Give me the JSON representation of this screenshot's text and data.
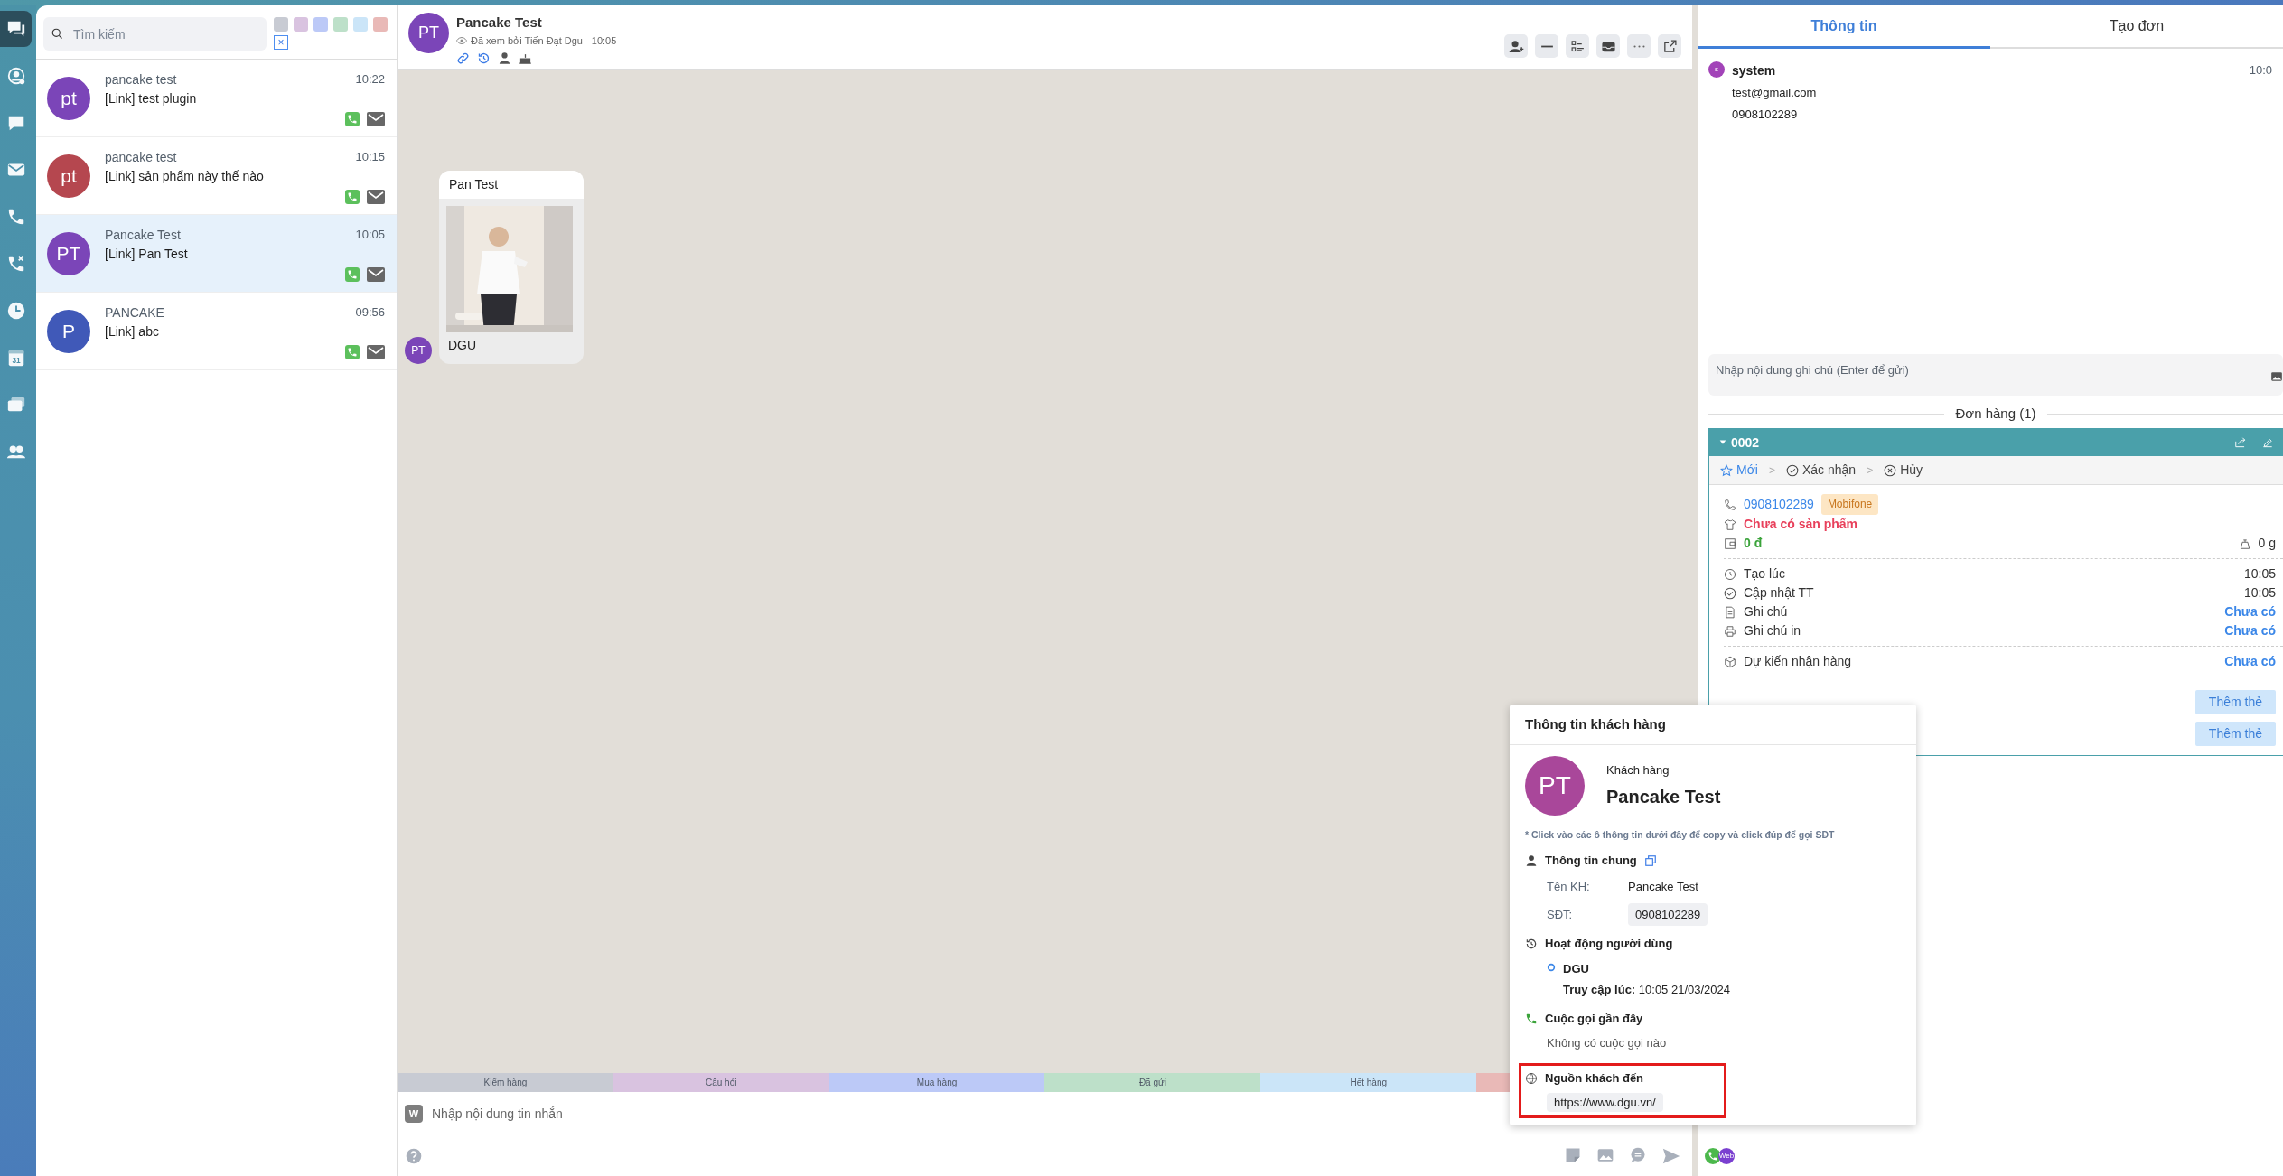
{
  "rail": [
    {
      "kind": "chat",
      "selected": true
    },
    {
      "kind": "contact",
      "selected": false
    },
    {
      "kind": "message",
      "selected": false
    },
    {
      "kind": "mail",
      "selected": false
    },
    {
      "kind": "phone",
      "selected": false
    },
    {
      "kind": "phone_missed",
      "selected": false
    },
    {
      "kind": "clock",
      "selected": false
    },
    {
      "kind": "calendar",
      "selected": false,
      "label": "31"
    },
    {
      "kind": "cards",
      "selected": false
    },
    {
      "kind": "people",
      "selected": false
    }
  ],
  "search": {
    "placeholder": "Tìm kiếm"
  },
  "tag_filters": [
    {
      "color": "#c8cbd3"
    },
    {
      "color": "#d9c3e0"
    },
    {
      "color": "#bcc9f7"
    },
    {
      "color": "#bde0c9"
    },
    {
      "color": "#cbe5f8"
    },
    {
      "color": "#e9b9b7"
    }
  ],
  "clear_filter": "×",
  "conversations": [
    {
      "initials": "pt",
      "color": "#7b45b8",
      "name": "pancake test",
      "preview": "[Link] test plugin",
      "time": "10:22",
      "selected": false
    },
    {
      "initials": "pt",
      "color": "#b5474f",
      "name": "pancake test",
      "preview": "[Link] sản phẩm này thế nào",
      "time": "10:15",
      "selected": false
    },
    {
      "initials": "PT",
      "color": "#7b45b8",
      "name": "Pancake Test",
      "preview": "[Link] Pan Test",
      "time": "10:05",
      "selected": true
    },
    {
      "initials": "P",
      "color": "#4059b8",
      "name": "PANCAKE",
      "preview": "[Link] abc",
      "time": "09:56",
      "selected": false
    }
  ],
  "chat": {
    "initials": "PT",
    "name": "Pancake Test",
    "seen": "Đã xem bởi Tiến Đạt Dgu - 10:05",
    "messages": [
      {
        "initials": "PT",
        "title": "Pan Test",
        "caption": "DGU"
      }
    ],
    "tags": [
      {
        "label": "Kiểm hàng",
        "color": "#c8cbd3"
      },
      {
        "label": "Câu hỏi",
        "color": "#d9c3e0"
      },
      {
        "label": "Mua hàng",
        "color": "#bcc9f7"
      },
      {
        "label": "Đã gửi",
        "color": "#bde0c9"
      },
      {
        "label": "Hết hàng",
        "color": "#cbe5f8"
      },
      {
        "color": "#e9b9b7"
      }
    ],
    "sender_badge": "W",
    "input": {
      "placeholder": "Nhập nội dung tin nhắn"
    }
  },
  "info_panel": {
    "tabs": [
      {
        "label": "Thông tin",
        "selected": true
      },
      {
        "label": "Tạo đơn",
        "selected": false
      }
    ],
    "notes": [
      {
        "author": "system",
        "avatar": "s",
        "time": "10:0",
        "lines": [
          "test@gmail.com",
          "0908102289"
        ]
      }
    ],
    "note_input": {
      "placeholder": "Nhập nội dung ghi chú (Enter để gửi)"
    },
    "orders_title": "Đơn hàng (1)",
    "order": {
      "code": "0002",
      "expanded": true,
      "steps": [
        {
          "kind": "star",
          "label": "Mới",
          "selected": true
        },
        {
          "kind": "check",
          "label": "Xác nhận",
          "selected": false
        },
        {
          "kind": "cancel",
          "label": "Hủy",
          "selected": false
        }
      ],
      "step_separator": ">",
      "phone": "0908102289",
      "carrier": "Mobifone",
      "products": "Chưa có sản phẩm",
      "total": "0 đ",
      "weight": "0 g",
      "details": [
        {
          "kind": "clock",
          "label": "Tạo lúc",
          "value": "10:05",
          "link": false
        },
        {
          "kind": "check",
          "label": "Cập nhật TT",
          "value": "10:05",
          "link": false
        },
        {
          "kind": "note",
          "label": "Ghi chú",
          "value": "Chưa có",
          "link": true
        },
        {
          "kind": "printer",
          "label": "Ghi chú in",
          "value": "Chưa có",
          "link": true
        }
      ],
      "delivery": {
        "label": "Dự kiến nhận hàng",
        "value": "Chưa có",
        "link": true
      },
      "tag_buttons": [
        "Thêm thẻ",
        "Thêm thẻ"
      ]
    },
    "channels": [
      {
        "kind": "phone"
      },
      {
        "kind": "web",
        "label": "Web"
      }
    ]
  },
  "customer_popup": {
    "title": "Thông tin khách hàng",
    "initials": "PT",
    "role": "Khách hàng",
    "name": "Pancake Test",
    "hint": "* Click vào các ô thông tin dưới đây để copy và click đúp để gọi SĐT",
    "general": {
      "title": "Thông tin chung",
      "fields": [
        {
          "label": "Tên KH:",
          "value": "Pancake Test",
          "boxed": false
        },
        {
          "label": "SĐT:",
          "value": "0908102289",
          "boxed": true
        }
      ]
    },
    "activity": {
      "title": "Hoạt động người dùng",
      "items": [
        {
          "site": "DGU",
          "visited": "**Truy cập lúc:** 10:05 21/03/2024"
        }
      ]
    },
    "calls": {
      "title": "Cuộc gọi gần đây",
      "empty": "Không có cuộc gọi nào"
    },
    "source": {
      "title": "Nguồn khách đến",
      "url": "https://www.dgu.vn/",
      "highlighted": true
    }
  }
}
